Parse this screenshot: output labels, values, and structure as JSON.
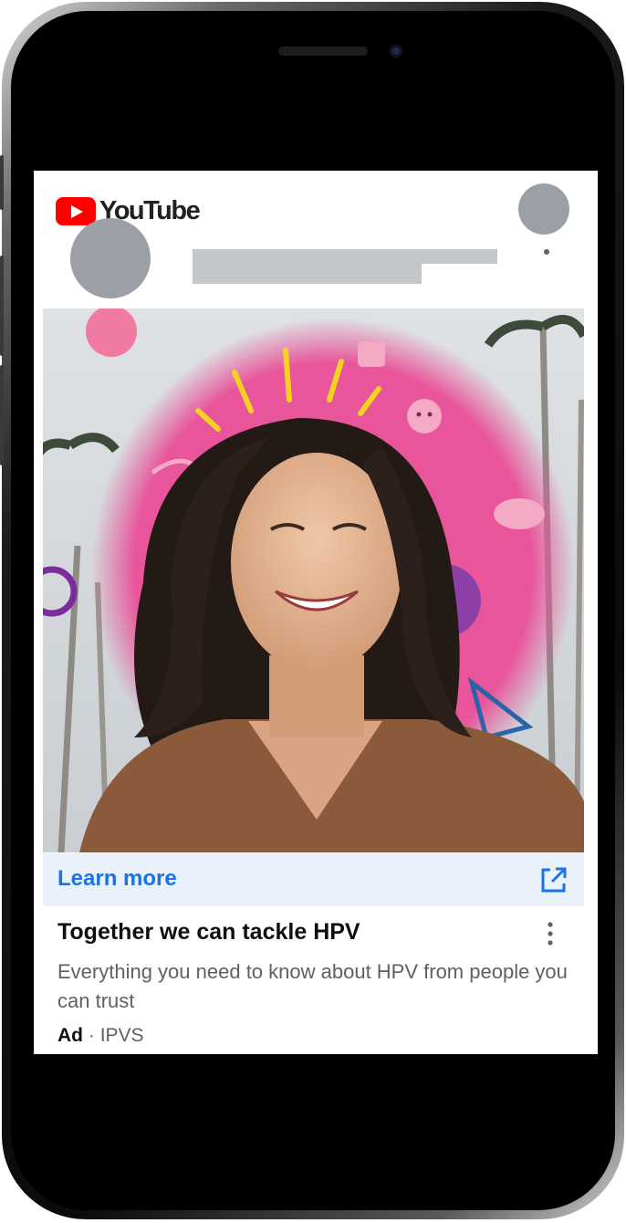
{
  "header": {
    "logo_text": "YouTube"
  },
  "ad": {
    "cta_label": "Learn more",
    "cta_icon": "open-in-new-icon",
    "title": "Together we can tackle HPV",
    "description": "Everything you need to know about HPV from people you can trust",
    "badge": "Ad",
    "separator": "·",
    "advertiser": "IPVS",
    "menu_icon": "more-vert-icon"
  },
  "colors": {
    "youtube_red": "#ff0000",
    "link_blue": "#1a73e8",
    "cta_background": "#e9f1fb",
    "placeholder_gray": "#9aa0a6",
    "ad_pink": "#e8559b"
  }
}
